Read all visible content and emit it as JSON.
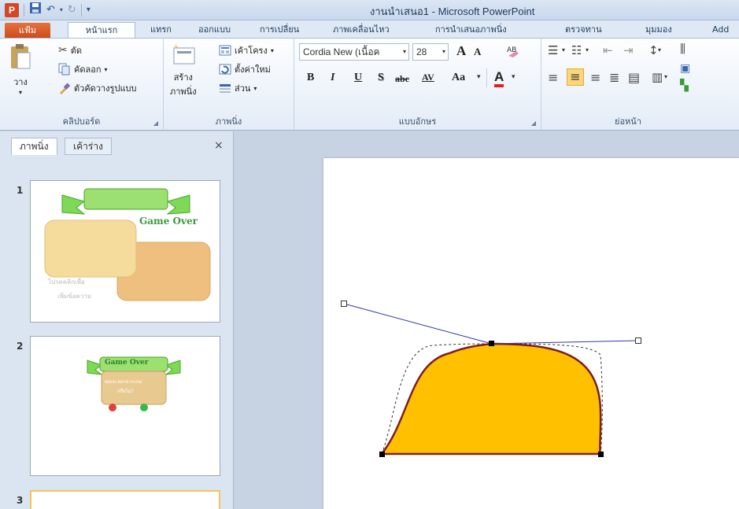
{
  "window": {
    "title": "งานนำเสนอ1 - Microsoft PowerPoint",
    "app_icon_letter": "P"
  },
  "tabs": [
    {
      "label": "แฟ้ม",
      "active": false
    },
    {
      "label": "หน้าแรก",
      "active": true
    },
    {
      "label": "แทรก",
      "active": false
    },
    {
      "label": "ออกแบบ",
      "active": false
    },
    {
      "label": "การเปลี่ยน",
      "active": false
    },
    {
      "label": "ภาพเคลื่อนไหว",
      "active": false
    },
    {
      "label": "การนำเสนอภาพนิ่ง",
      "active": false
    },
    {
      "label": "ตรวจทาน",
      "active": false
    },
    {
      "label": "มุมมอง",
      "active": false
    },
    {
      "label": "Add",
      "active": false
    }
  ],
  "ribbon": {
    "clipboard": {
      "label": "คลิปบอร์ด",
      "paste": "วาง",
      "cut": "ตัด",
      "copy": "คัดลอก",
      "format_painter": "ตัวคัดวางรูปแบบ"
    },
    "slides": {
      "label": "ภาพนิ่ง",
      "new_slide_line1": "สร้าง",
      "new_slide_line2": "ภาพนิ่ง",
      "layout": "เค้าโครง",
      "reset": "ตั้งค่าใหม่",
      "section": "ส่วน"
    },
    "font": {
      "label": "แบบอักษร",
      "font_name": "Cordia New (เนื้อค",
      "font_size": "28",
      "grow": "A",
      "shrink": "A",
      "bold": "B",
      "italic": "I",
      "underline": "U",
      "shadow": "S",
      "strike": "abc",
      "spacing": "AV",
      "case": "Aa",
      "color": "A"
    },
    "paragraph": {
      "label": "ย่อหน้า"
    }
  },
  "left_panel": {
    "tab_slides": "ภาพนิ่ง",
    "tab_outline": "เค้าร่าง",
    "close": "×",
    "slides": [
      {
        "number": "1",
        "banner_text": "Game Over",
        "caption_line1": "โปรดคลิกเพื่อ",
        "caption_line2": "เพิ่มข้อความ"
      },
      {
        "number": "2",
        "banner_text": "Game Over",
        "caption_line1": "คุณจะออกจากเกม",
        "caption_line2": "หรือไม่?"
      },
      {
        "number": "3",
        "selected": true
      }
    ]
  },
  "colors": {
    "shape_fill": "#ffc000",
    "shape_outline": "#7b1f1f",
    "handle_line": "#2e3a9f",
    "file_tab": "#d6541e",
    "banner_green": "#7ed957",
    "box_light": "#f5dc9c",
    "box_dark": "#eebf7f"
  }
}
